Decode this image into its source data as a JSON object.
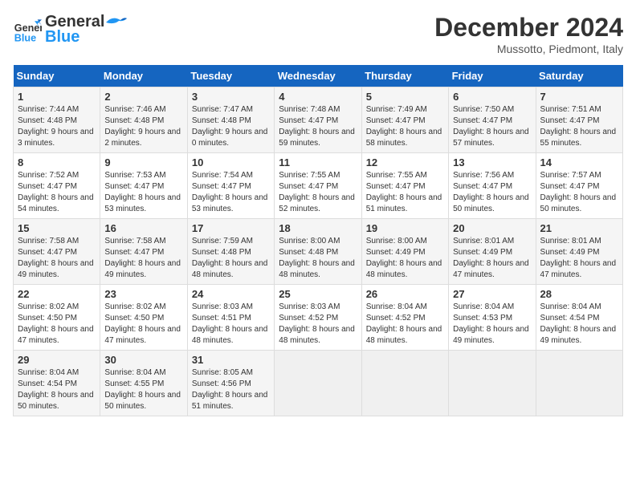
{
  "header": {
    "logo_line1": "General",
    "logo_line2": "Blue",
    "month_year": "December 2024",
    "location": "Mussotto, Piedmont, Italy"
  },
  "days_of_week": [
    "Sunday",
    "Monday",
    "Tuesday",
    "Wednesday",
    "Thursday",
    "Friday",
    "Saturday"
  ],
  "weeks": [
    [
      {
        "day": "1",
        "sunrise": "7:44 AM",
        "sunset": "4:48 PM",
        "daylight": "9 hours and 3 minutes."
      },
      {
        "day": "2",
        "sunrise": "7:46 AM",
        "sunset": "4:48 PM",
        "daylight": "9 hours and 2 minutes."
      },
      {
        "day": "3",
        "sunrise": "7:47 AM",
        "sunset": "4:48 PM",
        "daylight": "9 hours and 0 minutes."
      },
      {
        "day": "4",
        "sunrise": "7:48 AM",
        "sunset": "4:47 PM",
        "daylight": "8 hours and 59 minutes."
      },
      {
        "day": "5",
        "sunrise": "7:49 AM",
        "sunset": "4:47 PM",
        "daylight": "8 hours and 58 minutes."
      },
      {
        "day": "6",
        "sunrise": "7:50 AM",
        "sunset": "4:47 PM",
        "daylight": "8 hours and 57 minutes."
      },
      {
        "day": "7",
        "sunrise": "7:51 AM",
        "sunset": "4:47 PM",
        "daylight": "8 hours and 55 minutes."
      }
    ],
    [
      {
        "day": "8",
        "sunrise": "7:52 AM",
        "sunset": "4:47 PM",
        "daylight": "8 hours and 54 minutes."
      },
      {
        "day": "9",
        "sunrise": "7:53 AM",
        "sunset": "4:47 PM",
        "daylight": "8 hours and 53 minutes."
      },
      {
        "day": "10",
        "sunrise": "7:54 AM",
        "sunset": "4:47 PM",
        "daylight": "8 hours and 53 minutes."
      },
      {
        "day": "11",
        "sunrise": "7:55 AM",
        "sunset": "4:47 PM",
        "daylight": "8 hours and 52 minutes."
      },
      {
        "day": "12",
        "sunrise": "7:55 AM",
        "sunset": "4:47 PM",
        "daylight": "8 hours and 51 minutes."
      },
      {
        "day": "13",
        "sunrise": "7:56 AM",
        "sunset": "4:47 PM",
        "daylight": "8 hours and 50 minutes."
      },
      {
        "day": "14",
        "sunrise": "7:57 AM",
        "sunset": "4:47 PM",
        "daylight": "8 hours and 50 minutes."
      }
    ],
    [
      {
        "day": "15",
        "sunrise": "7:58 AM",
        "sunset": "4:47 PM",
        "daylight": "8 hours and 49 minutes."
      },
      {
        "day": "16",
        "sunrise": "7:58 AM",
        "sunset": "4:47 PM",
        "daylight": "8 hours and 49 minutes."
      },
      {
        "day": "17",
        "sunrise": "7:59 AM",
        "sunset": "4:48 PM",
        "daylight": "8 hours and 48 minutes."
      },
      {
        "day": "18",
        "sunrise": "8:00 AM",
        "sunset": "4:48 PM",
        "daylight": "8 hours and 48 minutes."
      },
      {
        "day": "19",
        "sunrise": "8:00 AM",
        "sunset": "4:49 PM",
        "daylight": "8 hours and 48 minutes."
      },
      {
        "day": "20",
        "sunrise": "8:01 AM",
        "sunset": "4:49 PM",
        "daylight": "8 hours and 47 minutes."
      },
      {
        "day": "21",
        "sunrise": "8:01 AM",
        "sunset": "4:49 PM",
        "daylight": "8 hours and 47 minutes."
      }
    ],
    [
      {
        "day": "22",
        "sunrise": "8:02 AM",
        "sunset": "4:50 PM",
        "daylight": "8 hours and 47 minutes."
      },
      {
        "day": "23",
        "sunrise": "8:02 AM",
        "sunset": "4:50 PM",
        "daylight": "8 hours and 47 minutes."
      },
      {
        "day": "24",
        "sunrise": "8:03 AM",
        "sunset": "4:51 PM",
        "daylight": "8 hours and 48 minutes."
      },
      {
        "day": "25",
        "sunrise": "8:03 AM",
        "sunset": "4:52 PM",
        "daylight": "8 hours and 48 minutes."
      },
      {
        "day": "26",
        "sunrise": "8:04 AM",
        "sunset": "4:52 PM",
        "daylight": "8 hours and 48 minutes."
      },
      {
        "day": "27",
        "sunrise": "8:04 AM",
        "sunset": "4:53 PM",
        "daylight": "8 hours and 49 minutes."
      },
      {
        "day": "28",
        "sunrise": "8:04 AM",
        "sunset": "4:54 PM",
        "daylight": "8 hours and 49 minutes."
      }
    ],
    [
      {
        "day": "29",
        "sunrise": "8:04 AM",
        "sunset": "4:54 PM",
        "daylight": "8 hours and 50 minutes."
      },
      {
        "day": "30",
        "sunrise": "8:04 AM",
        "sunset": "4:55 PM",
        "daylight": "8 hours and 50 minutes."
      },
      {
        "day": "31",
        "sunrise": "8:05 AM",
        "sunset": "4:56 PM",
        "daylight": "8 hours and 51 minutes."
      },
      null,
      null,
      null,
      null
    ]
  ],
  "labels": {
    "sunrise": "Sunrise:",
    "sunset": "Sunset:",
    "daylight": "Daylight:"
  }
}
